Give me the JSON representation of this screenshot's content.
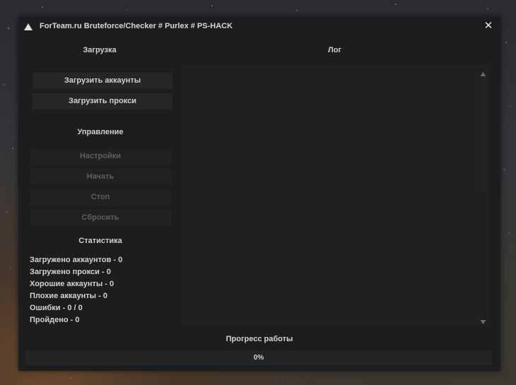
{
  "window": {
    "title": "ForTeam.ru Bruteforce/Checker # Purlex # PS-HACK",
    "close_glyph": "✕"
  },
  "load_section": {
    "title": "Загрузка",
    "load_accounts_label": "Загрузить аккаунты",
    "load_proxies_label": "Загрузить прокси"
  },
  "control_section": {
    "title": "Управление",
    "settings_label": "Настройки",
    "start_label": "Начать",
    "stop_label": "Стоп",
    "reset_label": "Сбросить"
  },
  "stats_section": {
    "title": "Статистика",
    "rows": [
      "Загружено аккаунтов - 0",
      "Загружено прокси - 0",
      "Хорошие аккаунты - 0",
      "Плохие аккаунты - 0",
      "Ошибки - 0 / 0",
      "Пройдено - 0"
    ]
  },
  "log_section": {
    "title": "Лог",
    "content": ""
  },
  "progress": {
    "label": "Прогресс работы",
    "value_text": "0%",
    "fraction": 0
  },
  "icons": {
    "app": "app-logo-icon",
    "close": "close-icon",
    "scroll_up": "arrow-up-icon",
    "scroll_down": "arrow-down-icon"
  },
  "colors": {
    "window_bg": "#1c1d1f",
    "button_bg": "#252628",
    "disabled_text": "#5d5e60",
    "text": "#d2d2d2"
  }
}
